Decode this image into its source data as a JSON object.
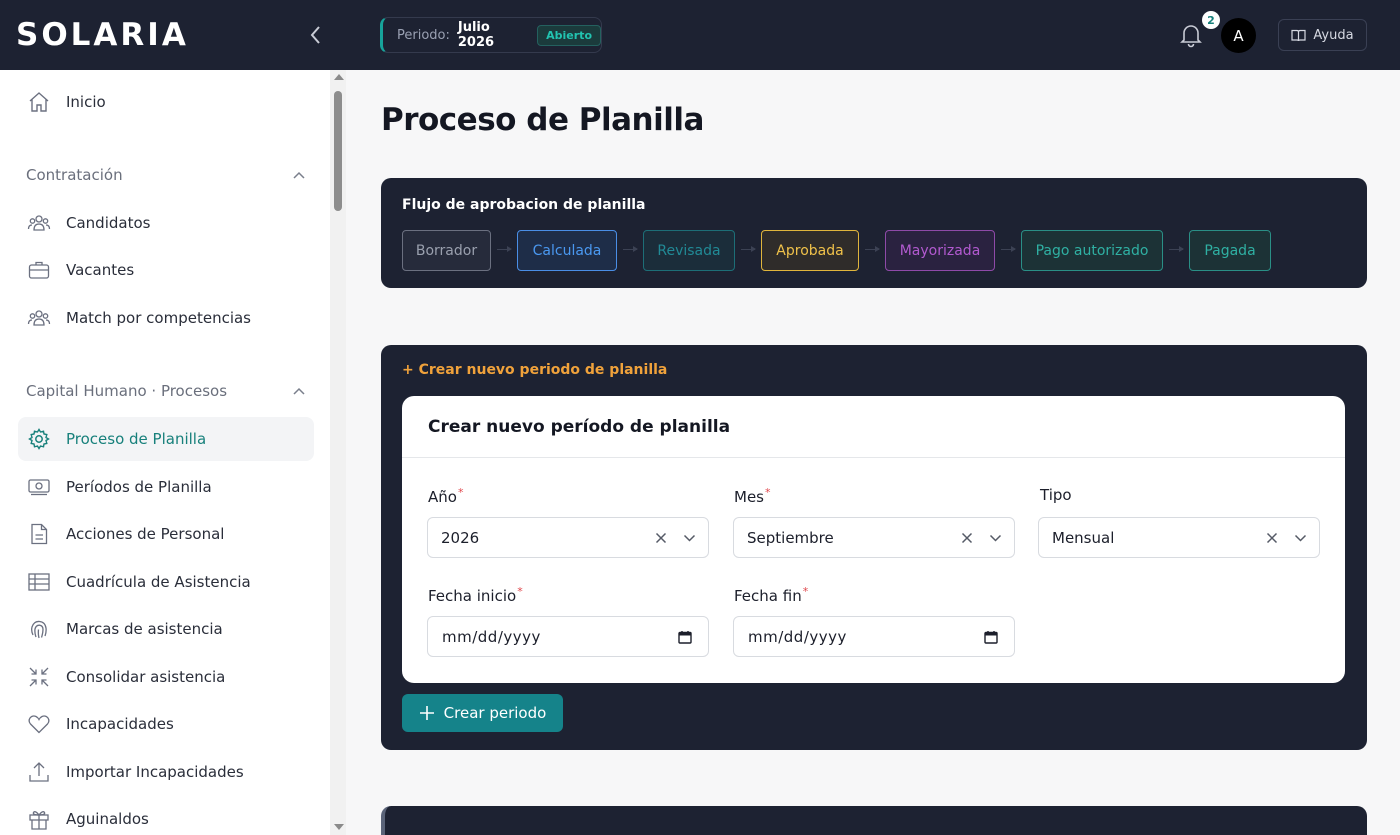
{
  "app": {
    "logo_text": "SOLARIA"
  },
  "topbar": {
    "period_label": "Periodo:",
    "period_value": "Julio 2026",
    "period_status": "Abierto",
    "notifications_count": "2",
    "avatar_initial": "A",
    "help_label": "Ayuda"
  },
  "sidebar": {
    "home": "Inicio",
    "section_contratacion": "Contratación",
    "contratacion_items": [
      "Candidatos",
      "Vacantes",
      "Match por competencias"
    ],
    "section_capital": "Capital Humano · Procesos",
    "capital_items": [
      "Proceso de Planilla",
      "Períodos de Planilla",
      "Acciones de Personal",
      "Cuadrícula de Asistencia",
      "Marcas de asistencia",
      "Consolidar asistencia",
      "Incapacidades",
      "Importar Incapacidades",
      "Aguinaldos"
    ]
  },
  "main": {
    "page_title": "Proceso de Planilla",
    "flow": {
      "title": "Flujo de aprobacion de planilla",
      "steps": [
        "Borrador",
        "Calculada",
        "Revisada",
        "Aprobada",
        "Mayorizada",
        "Pago autorizado",
        "Pagada"
      ]
    },
    "create": {
      "link_label": "+ Crear nuevo periodo de planilla",
      "form_title": "Crear nuevo período de planilla",
      "year_label": "Año",
      "year_value": "2026",
      "month_label": "Mes",
      "month_value": "Septiembre",
      "type_label": "Tipo",
      "type_value": "Mensual",
      "start_label": "Fecha inicio",
      "start_placeholder": "mm/dd/yyyy",
      "end_label": "Fecha fin",
      "end_placeholder": "mm/dd/yyyy",
      "submit_label": "Crear periodo"
    }
  },
  "colors": {
    "topbar_bg": "#1d2232",
    "accent_teal": "#17807b",
    "orange_link": "#f0a23b",
    "required": "#e0474c"
  }
}
